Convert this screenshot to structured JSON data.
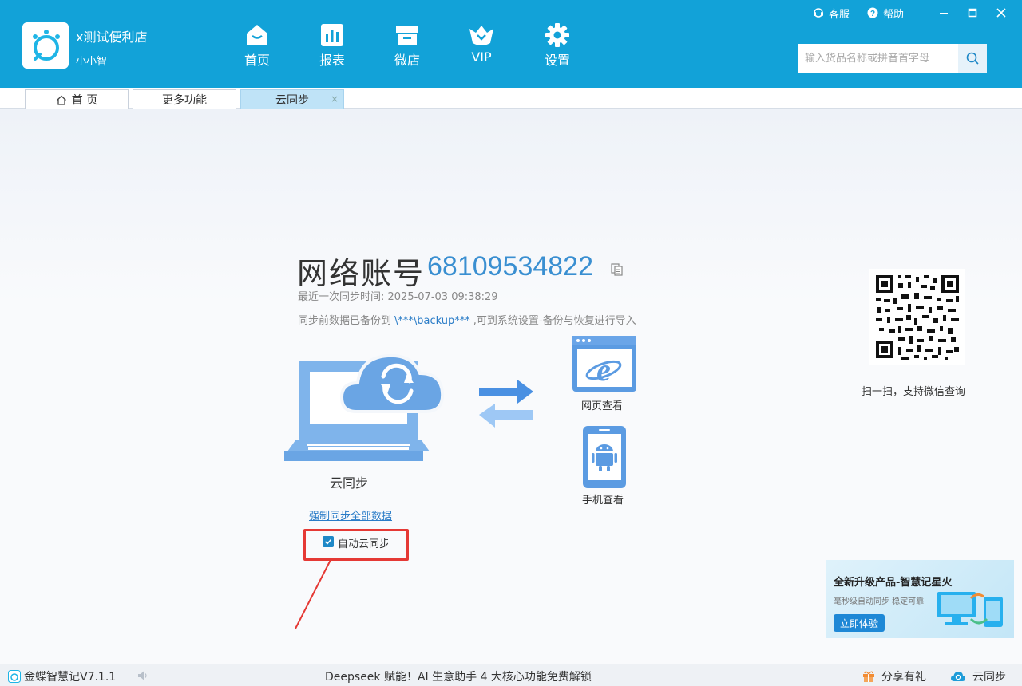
{
  "header": {
    "store_name": "x测试便利店",
    "user_name": "小小智",
    "nav": [
      {
        "label": "首页",
        "icon": "home-icon"
      },
      {
        "label": "报表",
        "icon": "bar-chart-icon"
      },
      {
        "label": "微店",
        "icon": "shop-icon"
      },
      {
        "label": "VIP",
        "icon": "crown-icon"
      },
      {
        "label": "设置",
        "icon": "gear-icon"
      }
    ],
    "top_links": {
      "service": "客服",
      "help": "帮助"
    },
    "search_placeholder": "输入货品名称或拼音首字母"
  },
  "tabs": [
    {
      "label": "首 页",
      "active": false
    },
    {
      "label": "更多功能",
      "active": false
    },
    {
      "label": "云同步",
      "active": true,
      "close": "×"
    }
  ],
  "main": {
    "account_label": "网络账号",
    "account_number": "68109534822",
    "last_sync": "最近一次同步时间: 2025-07-03 09:38:29",
    "backup_prefix": "同步前数据已备份到",
    "backup_path": "\\***\\backup***",
    "backup_suffix": ",可到系统设置-备份与恢复进行导入",
    "sync_label": "云同步",
    "force_sync": "强制同步全部数据",
    "auto_sync": "自动云同步",
    "auto_sync_checked": true,
    "web_view": "网页查看",
    "mobile_view": "手机查看",
    "qr_caption": "扫一扫，支持微信查询"
  },
  "promo": {
    "title": "全新升级产品-智慧记星火",
    "subtitle": "毫秒级自动同步 稳定可靠",
    "button": "立即体验"
  },
  "status": {
    "version": "金蝶智慧记V7.1.1",
    "ticker": "Deepseek 赋能！AI 生意助手 4 大核心功能免费解锁",
    "share": "分享有礼",
    "cloud_sync": "云同步"
  },
  "colors": {
    "header": "#12a2d8",
    "accent": "#3a8fd1",
    "highlight": "#e53935"
  }
}
